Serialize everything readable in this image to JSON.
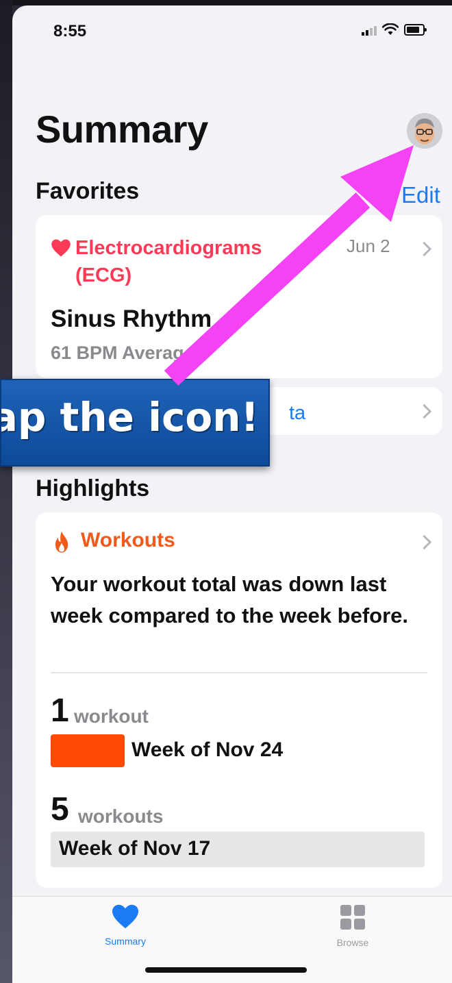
{
  "status_bar": {
    "time": "8:55"
  },
  "header": {
    "title": "Summary"
  },
  "favorites": {
    "section_title": "Favorites",
    "edit_label": "Edit",
    "ecg_card": {
      "title": "Electrocardiograms (ECG)",
      "date": "Jun 2",
      "value": "Sinus Rhythm",
      "subtitle": "61 BPM Average"
    },
    "data_card": {
      "label": "ta"
    }
  },
  "highlights": {
    "section_title": "Highlights",
    "workouts_card": {
      "title": "Workouts",
      "description": "Your workout total was down last week compared to the week before.",
      "current": {
        "count": "1",
        "unit": "workout",
        "label": "Week of Nov 24"
      },
      "previous": {
        "count": "5",
        "unit": "workouts",
        "label": "Week of Nov 17"
      }
    }
  },
  "tab_bar": {
    "tabs": [
      {
        "label": "Summary",
        "icon": "heart-icon",
        "active": true
      },
      {
        "label": "Browse",
        "icon": "grid-icon",
        "active": false
      }
    ]
  },
  "annotation": {
    "banner_text": "Tap the icon!",
    "arrow_color": "#f442f4",
    "banner_color": "#1456a8"
  },
  "colors": {
    "accent_blue": "#1a7cf5",
    "ecg_red": "#fa3a57",
    "workout_orange": "#ff4a06"
  }
}
